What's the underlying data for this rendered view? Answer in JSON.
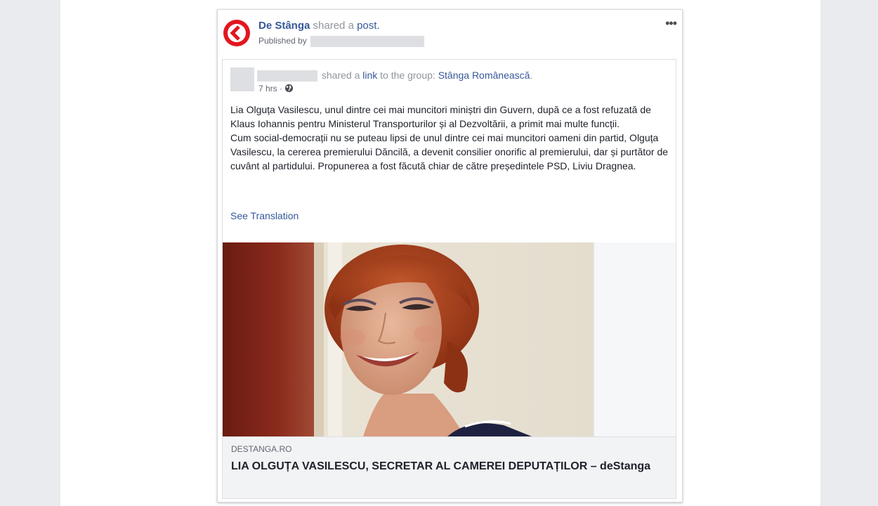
{
  "post": {
    "page_name": "De Stânga",
    "shared_text": "shared a",
    "post_link": "post.",
    "published_by_label": "Published by"
  },
  "shared": {
    "shared_text": "shared a",
    "link_word": "link",
    "to_group_text": "to the group:",
    "group_name": "Stânga Românească",
    "group_suffix": ".",
    "time": "7 hrs",
    "time_separator": "·",
    "paragraph_1": "Lia Olguța Vasilescu, unul dintre cei mai muncitori miniștri din Guvern, după ce a fost refuzată de Klaus Iohannis pentru Ministerul Transporturilor și al Dezvoltării, a primit mai multe funcții.",
    "paragraph_2": "Cum social-democrații nu se puteau lipsi de unul dintre cei mai muncitori oameni din partid, Olguța Vasilescu, la cererea premierului Dăncilă, a devenit consilier onorific al premierului, dar și purtător de cuvânt al partidului. Propunerea a fost făcută chiar de către președintele PSD, Liviu Dragnea.",
    "see_translation": "See Translation"
  },
  "link_preview": {
    "domain": "DESTANGA.RO",
    "title": "LIA OLGUȚA VASILESCU, SECRETAR AL CAMEREI DEPUTAȚILOR – deStanga"
  },
  "colors": {
    "link_blue": "#365899",
    "logo_red": "#e2161f",
    "redaction_gray": "#dddfe2"
  }
}
